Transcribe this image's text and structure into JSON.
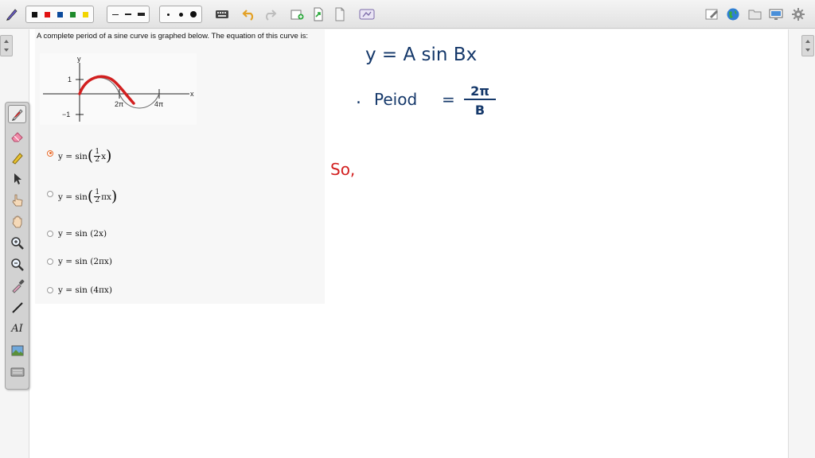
{
  "toolbar": {
    "pen_colors": [
      "#111111",
      "#e01010",
      "#0b4a9c",
      "#1d8a2a",
      "#f2d500"
    ],
    "line_styles": [
      "dashed-line",
      "medium-line",
      "thick-line"
    ],
    "pen_sizes": [
      "small-dot",
      "medium-dot",
      "large-dot"
    ]
  },
  "question": {
    "prompt": "A complete period of a sine curve is graphed below. The equation of this curve is:",
    "graph": {
      "y_label": "y",
      "x_label": "x",
      "y_ticks": [
        "1",
        "−1"
      ],
      "x_ticks": [
        "2π",
        "4π"
      ],
      "curve_color": "#d21f1f"
    },
    "options": [
      {
        "prefix": "y = sin",
        "frac_num": "1",
        "frac_den": "2",
        "frac_after": "x",
        "selected": true
      },
      {
        "prefix": "y = sin",
        "frac_num": "1",
        "frac_den": "2",
        "frac_after": "πx",
        "selected": false
      },
      {
        "text": "y = sin (2x)",
        "selected": false
      },
      {
        "text": "y = sin (2πx)",
        "selected": false
      },
      {
        "text": "y = sin (4πx)",
        "selected": false
      }
    ]
  },
  "handwriting": {
    "line1": "y =  A sin Bx",
    "line2_bullet": ".",
    "line2_word": "Peiod",
    "line2_equals": "=",
    "frac_num": "2π",
    "frac_den": "B",
    "so": "So,",
    "ink_color": "#15386a",
    "accent_color": "#d21f1f"
  },
  "tools": [
    "pen-tool",
    "eraser-tool",
    "highlighter-tool",
    "select-arrow-tool",
    "pointer-hand-tool",
    "pan-hand-tool",
    "zoom-in-tool",
    "zoom-out-tool",
    "eyedropper-tool",
    "line-tool",
    "text-tool",
    "image-tool",
    "keyboard-tool"
  ],
  "text_tool_label": "AΙ"
}
